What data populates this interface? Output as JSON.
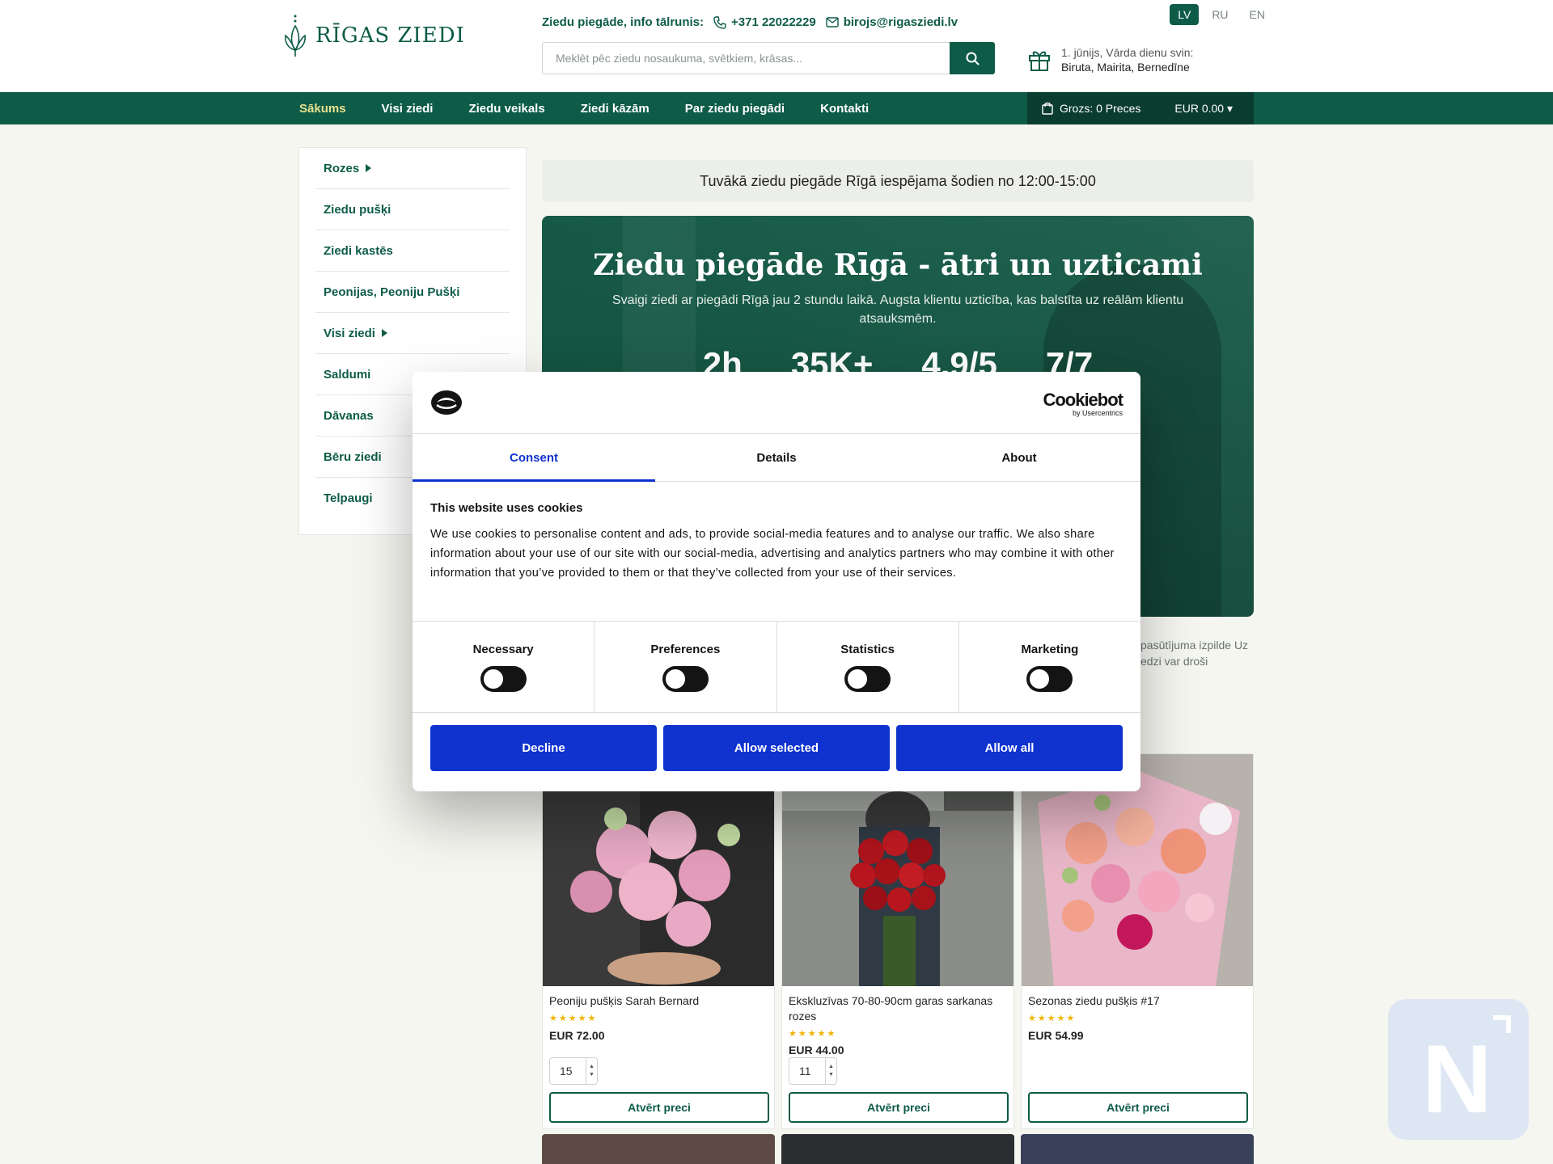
{
  "header": {
    "logo_text": "RĪGAS ZIEDI",
    "contact_label": "Ziedu piegāde, info tālrunis:",
    "phone": "+371 22022229",
    "email": "birojs@rigasziedi.lv",
    "search_placeholder": "Meklēt pēc ziedu nosaukuma, svētkiem, krāsas...",
    "name_day_label": "1. jūnijs, Vārda dienu svin:",
    "name_day_names": "Biruta, Mairita, Bernedīne",
    "languages": [
      "LV",
      "RU",
      "EN"
    ],
    "active_language": "LV"
  },
  "nav": {
    "items": [
      "Sākums",
      "Visi ziedi",
      "Ziedu veikals",
      "Ziedi kāzām",
      "Par ziedu piegādi",
      "Kontakti"
    ],
    "cart_label": "Grozs: 0 Preces",
    "currency_total": "EUR 0.00 ▾"
  },
  "sidebar": {
    "items": [
      "Rozes",
      "Ziedu pušķi",
      "Ziedi kastēs",
      "Peonijas, Peoniju Pušķi",
      "Visi ziedi",
      "Saldumi",
      "Dāvanas",
      "Bēru ziedi",
      "Telpaugi"
    ]
  },
  "notice": "Tuvākā ziedu piegāde Rīgā iespējama šodien no 12:00-15:00",
  "hero": {
    "title": "Ziedu piegāde Rīgā - ātri un uzticami",
    "subtitle": "Svaigi ziedi ar piegādi Rīgā jau 2 stundu laikā. Augsta klientu uzticība, kas balstīta uz reālām klientu atsauksmēm.",
    "stats": [
      "2h",
      "35K+",
      "4.9/5",
      "7/7"
    ]
  },
  "partial_text": {
    "line1": "pasūtījuma izpilde Uz",
    "line2": "edzi var droši"
  },
  "products": [
    {
      "name": "Peoniju pušķis Sarah Bernard",
      "stars": "★★★★★",
      "price": "EUR 72.00",
      "qty": "15",
      "button": "Atvērt preci",
      "image_colors": [
        "#2b2b2b",
        "#e8a9c4",
        "#c3dca3"
      ]
    },
    {
      "name": "Ekskluzīvas 70-80-90cm garas sarkanas rozes",
      "stars": "★★★★★",
      "price": "EUR 44.00",
      "qty": "11",
      "button": "Atvērt preci",
      "image_colors": [
        "#8a8c88",
        "#b0141c",
        "#3a4a3a"
      ]
    },
    {
      "name": "Sezonas ziedu pušķis #17",
      "stars": "★★★★★",
      "price": "EUR 54.99",
      "qty": "",
      "button": "Atvērt preci",
      "image_colors": [
        "#b8b2ac",
        "#f3a08a",
        "#e88fb0"
      ]
    }
  ],
  "cookie": {
    "brand": "Cookiebot",
    "brand_sub": "by Usercentrics",
    "tabs": [
      "Consent",
      "Details",
      "About"
    ],
    "active_tab": "Consent",
    "heading": "This website uses cookies",
    "body": "We use cookies to personalise content and ads, to provide social-media features and to analyse our traffic. We also share information about your use of our site with our social-media, advertising and analytics partners who may combine it with other information that you’ve provided to them or that they’ve collected from your use of their services.",
    "toggles": [
      "Necessary",
      "Preferences",
      "Statistics",
      "Marketing"
    ],
    "buttons": [
      "Decline",
      "Allow selected",
      "Allow all"
    ]
  },
  "colors": {
    "brand_green": "#0e5c48",
    "cookie_blue": "#1032cf"
  }
}
